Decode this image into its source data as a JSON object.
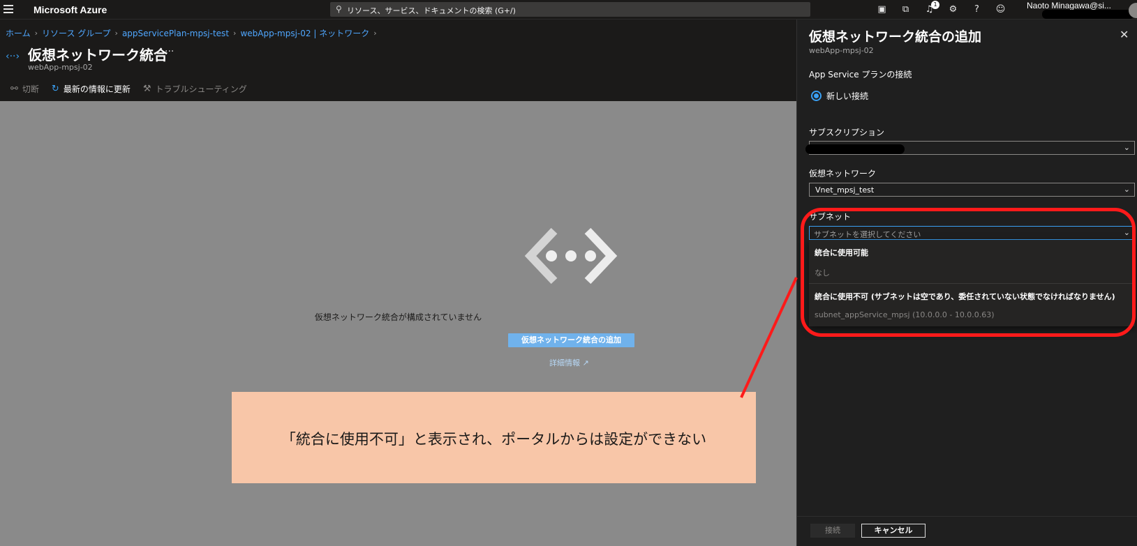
{
  "app": {
    "brand": "Microsoft Azure"
  },
  "search": {
    "placeholder": "リソース、サービス、ドキュメントの検索 (G+/)"
  },
  "topbar": {
    "icons": [
      "terminal-icon",
      "directory-filter-icon",
      "bell-icon",
      "gear-icon",
      "help-icon",
      "feedback-icon"
    ],
    "notification_count": "1",
    "user": "Naoto  Minagawa@si..."
  },
  "breadcrumb": {
    "items": [
      "ホーム",
      "リソース グループ",
      "appServicePlan-mpsj-test",
      "webApp-mpsj-02 | ネットワーク"
    ]
  },
  "blade": {
    "title": "仮想ネットワーク統合",
    "subtitle": "webApp-mpsj-02",
    "more": "···"
  },
  "commands": {
    "disconnect": "切断",
    "refresh": "最新の情報に更新",
    "troubleshoot": "トラブルシューティング"
  },
  "main": {
    "empty_message": "仮想ネットワーク統合が構成されていません",
    "add_button": "仮想ネットワーク統合の追加",
    "more_info": "詳細情報"
  },
  "note": {
    "text": "「統合に使用不可」と表示され、ポータルからは設定ができない",
    "color": "#f8c6a8"
  },
  "panel": {
    "title": "仮想ネットワーク統合の追加",
    "subtitle": "webApp-mpsj-02",
    "plan_connection_label": "App Service プランの接続",
    "new_connection": "新しい接続",
    "subscription_label": "サブスクリプション",
    "vnet_label": "仮想ネットワーク",
    "vnet_value": "Vnet_mpsj_test",
    "subnet_label": "サブネット",
    "subnet_placeholder": "サブネットを選択してください",
    "dropdown": {
      "available_header": "統合に使用可能",
      "available_none": "なし",
      "unavailable_header": "統合に使用不可 (サブネットは空であり、委任されていない状態でなければなりません)",
      "unavailable_item": "subnet_appService_mpsj (10.0.0.0 - 10.0.0.63)"
    },
    "connect_button": "接続",
    "cancel_button": "キャンセル"
  },
  "colors": {
    "accent": "#3aa0f3",
    "highlight": "#ff1a1a",
    "link": "#4fa7ff"
  }
}
